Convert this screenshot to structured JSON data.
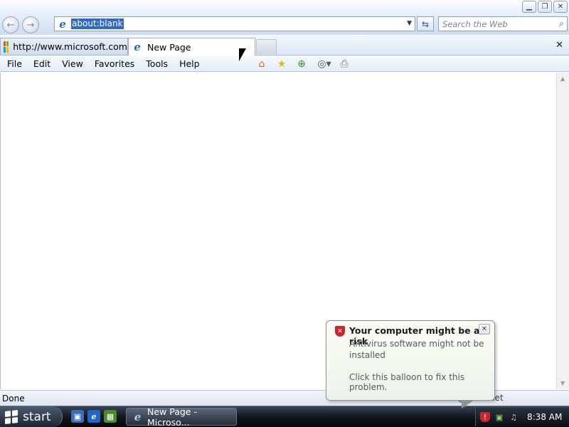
{
  "window": {
    "controls": [
      "minimize",
      "restore",
      "close"
    ]
  },
  "address_bar": {
    "url": "about:blank",
    "search_placeholder": "Search the Web"
  },
  "tabs": [
    {
      "label": "http://www.microsoft.com",
      "icon": "microsoft-logo-icon",
      "active": false
    },
    {
      "label": "New Page",
      "icon": "ie-icon",
      "active": true
    }
  ],
  "menu": {
    "items": [
      "File",
      "Edit",
      "View",
      "Favorites",
      "Tools",
      "Help"
    ]
  },
  "status": {
    "text": "Done",
    "zone": "Internet"
  },
  "taskbar": {
    "start_label": "start",
    "task_label": "New Page - Microso...",
    "clock": "8:38 AM"
  },
  "balloon": {
    "title": "Your computer might be at risk",
    "message": "Antivirus software might not be installed",
    "hint": "Click this balloon to fix this problem."
  },
  "colors": {
    "selection": "#3169c6",
    "alert_red": "#c8262d",
    "taskbar": "#12161e"
  }
}
